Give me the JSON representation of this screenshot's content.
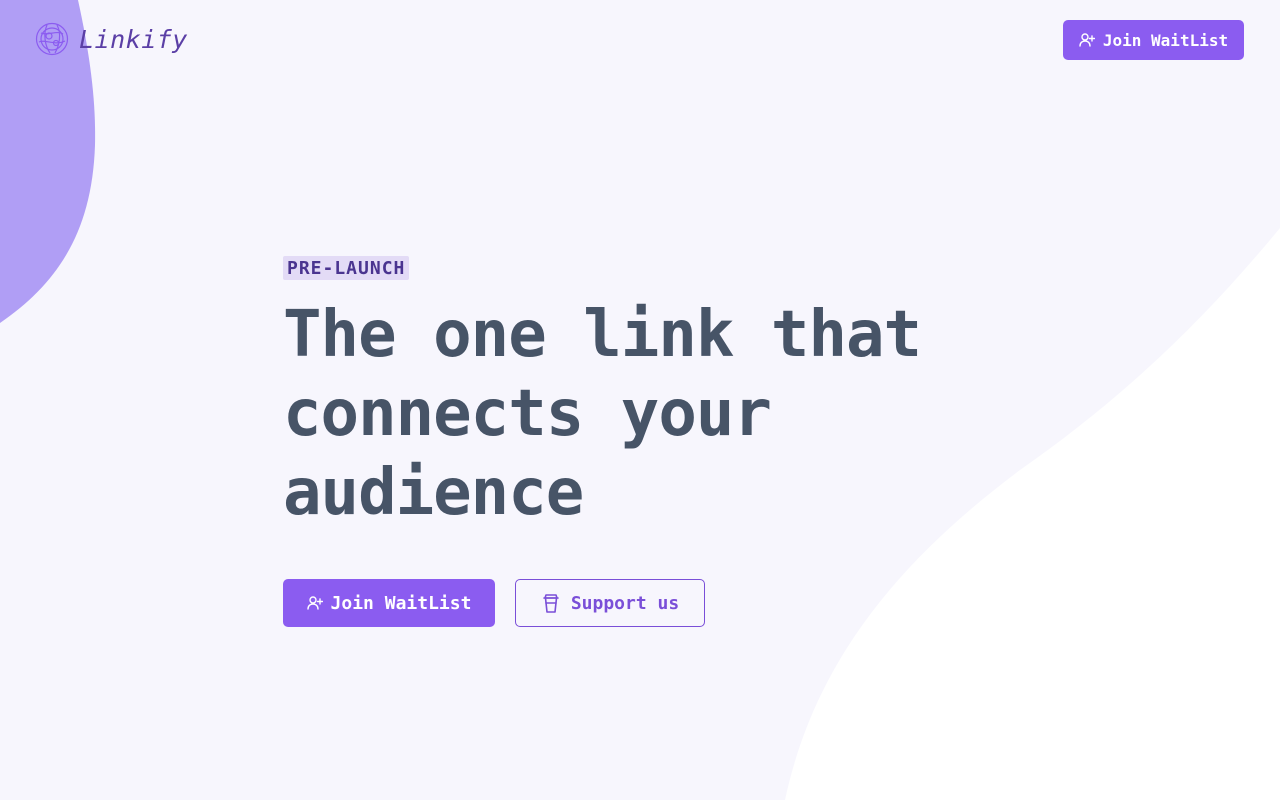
{
  "brand": {
    "name": "Linkify",
    "logo_icon": "globe-network-icon",
    "primary_color": "#8b5cf0",
    "blob_color": "#b09ef5"
  },
  "navbar": {
    "join_waitlist_label": "Join WaitList",
    "join_icon": "user-plus-icon"
  },
  "hero": {
    "badge": "PRE-LAUNCH",
    "headline": "The one link that connects your audience",
    "cta_primary_label": "Join WaitList",
    "cta_primary_icon": "user-plus-icon",
    "cta_secondary_label": "Support us",
    "cta_secondary_icon": "coffee-cup-icon"
  }
}
